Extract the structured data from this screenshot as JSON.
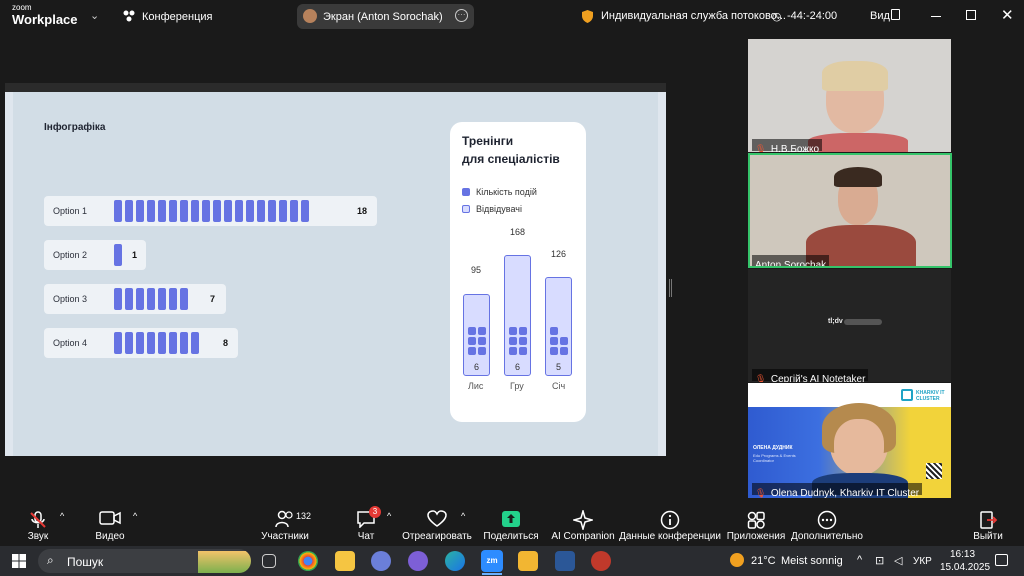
{
  "topbar": {
    "brand_line1": "zoom",
    "brand_line2": "Workplace",
    "meeting_title": "Конференция",
    "share_label": "Экран (Anton Sorochak)",
    "service_name": "Индивидуальная служба потоково...",
    "timer": "-44:-24:00",
    "view_label": "Вид"
  },
  "slide": {
    "heading": "Інфографіка",
    "options": [
      {
        "label": "Option 1",
        "value": "18"
      },
      {
        "label": "Option 2",
        "value": "1"
      },
      {
        "label": "Option 3",
        "value": "7"
      },
      {
        "label": "Option 4",
        "value": "8"
      }
    ],
    "card": {
      "title_line1": "Тренінги",
      "title_line2": "для спеціалістів",
      "legend_events": "Кількість подій",
      "legend_visitors": "Відвідувачі",
      "bars": [
        {
          "month": "Лис",
          "visitors": "95",
          "events": "6"
        },
        {
          "month": "Гру",
          "visitors": "168",
          "events": "6"
        },
        {
          "month": "Січ",
          "visitors": "126",
          "events": "5"
        }
      ]
    }
  },
  "participants": [
    {
      "name": "Н.В.Божко"
    },
    {
      "name": "Anton Sorochak"
    },
    {
      "name": "Сергій's AI Notetaker"
    },
    {
      "name": "Olena Dudnyk, Kharkiv IT Cluster"
    }
  ],
  "notetaker_logo": "tl;dv",
  "cluster_banner": {
    "org": "KHARKIV IT CLUSTER",
    "person": "ОЛЕНА ДУДНИК",
    "role": "Edu Programs & Events Coordinator"
  },
  "toolbar": {
    "audio": "Звук",
    "video": "Видео",
    "participants": "Участники",
    "participants_count": "132",
    "chat": "Чат",
    "chat_badge": "3",
    "react": "Отреагировать",
    "share": "Поделиться",
    "ai": "AI Companion",
    "info": "Данные конференции",
    "apps": "Приложения",
    "more": "Дополнительно",
    "leave": "Выйти"
  },
  "taskbar": {
    "search": "Пошук",
    "weather_temp": "21°C",
    "weather_text": "Meist sonnig",
    "lang": "УКР",
    "time": "16:13",
    "date": "15.04.2025"
  },
  "colors": {
    "accent": "#6673e3",
    "active_speaker": "#35c46a",
    "share_green": "#23d18b"
  }
}
